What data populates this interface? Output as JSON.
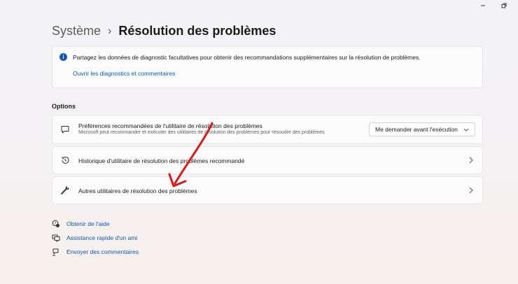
{
  "window": {
    "minimize_glyph": "–",
    "restore_glyph": "⧉"
  },
  "breadcrumb": {
    "parent": "Système",
    "separator": "›",
    "current": "Résolution des problèmes"
  },
  "info_banner": {
    "icon": "info-icon",
    "text": "Partagez les données de diagnostic facultatives pour obtenir des recommandations supplémentaires sur la résolution de problèmes.",
    "link": "Ouvrir les diagnostics et commentaires"
  },
  "options": {
    "section_label": "Options",
    "items": [
      {
        "icon": "chat-bubble-icon",
        "title": "Préférences recommandées de l'utilitaire de résolution des problèmes",
        "subtitle": "Microsoft peut recommander et exécuter des utilitaires de résolution des problèmes pour résoudre des problèmes",
        "dropdown_value": "Me demander avant l'exécution"
      },
      {
        "icon": "history-icon",
        "title": "Historique d'utilitaire de résolution des problèmes recommandé"
      },
      {
        "icon": "wrench-icon",
        "title": "Autres utilitaires de résolution des problèmes"
      }
    ]
  },
  "footer_links": [
    {
      "icon": "help-icon",
      "label": "Obtenir de l'aide"
    },
    {
      "icon": "remote-assist-icon",
      "label": "Assistance rapide d'un ami"
    },
    {
      "icon": "feedback-icon",
      "label": "Envoyer des commentaires"
    }
  ],
  "colors": {
    "accent": "#0a5bbd",
    "annotation_arrow": "#e0161a"
  }
}
